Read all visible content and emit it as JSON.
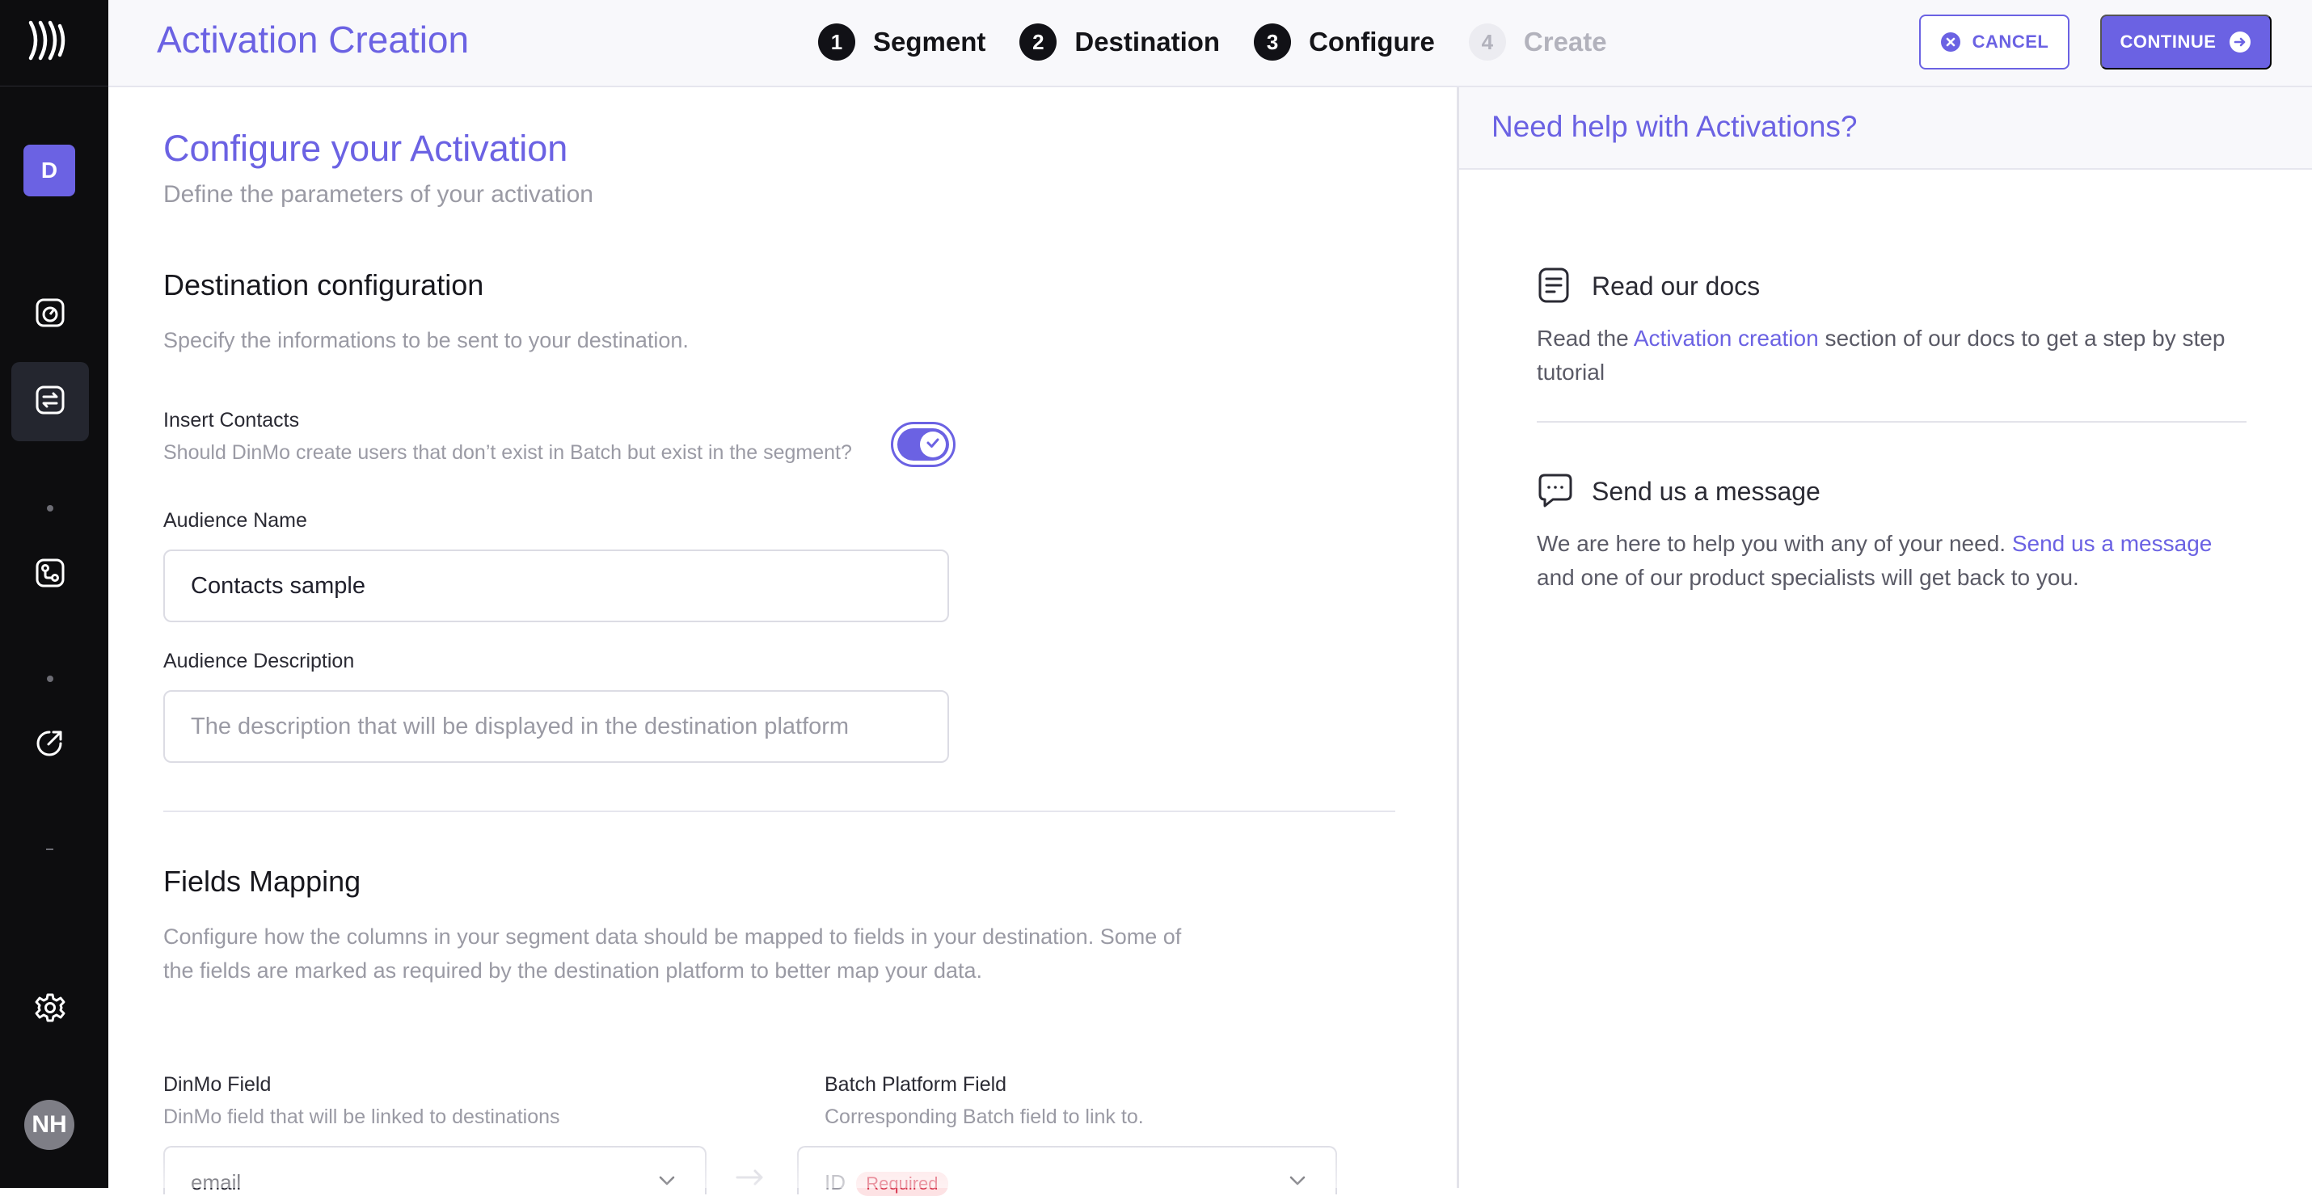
{
  "header": {
    "title": "Activation Creation",
    "steps": [
      {
        "num": "1",
        "label": "Segment"
      },
      {
        "num": "2",
        "label": "Destination"
      },
      {
        "num": "3",
        "label": "Configure"
      },
      {
        "num": "4",
        "label": "Create"
      }
    ],
    "cancel_label": "CANCEL",
    "continue_label": "CONTINUE"
  },
  "sidebar": {
    "workspace_initial": "D",
    "user_initials": "NH"
  },
  "main": {
    "title": "Configure your Activation",
    "subtitle": "Define the parameters of your activation",
    "destination_config": {
      "heading": "Destination configuration",
      "description": "Specify the informations to be sent to your destination.",
      "insert_contacts": {
        "label": "Insert Contacts",
        "hint": "Should DinMo create users that don’t exist in Batch but exist in the segment?",
        "enabled": true
      },
      "audience_name": {
        "label": "Audience Name",
        "value": "Contacts sample",
        "placeholder": ""
      },
      "audience_description": {
        "label": "Audience Description",
        "value": "",
        "placeholder": "The description that will be displayed in the destination platform"
      }
    },
    "fields_mapping": {
      "heading": "Fields Mapping",
      "description": "Configure how the columns in your segment data should be mapped to fields in your destination. Some of the fields are marked as required by the destination platform to better map your data.",
      "dinmo_field": {
        "label": "DinMo Field",
        "hint": "DinMo field that will be linked to destinations",
        "selected": "email"
      },
      "batch_field": {
        "label": "Batch Platform Field",
        "hint": "Corresponding Batch field to link to.",
        "selected": "ID",
        "badge": "Required"
      }
    }
  },
  "help": {
    "title": "Need help with Activations?",
    "docs": {
      "title": "Read our docs",
      "text_before": "Read the ",
      "link": "Activation creation",
      "text_after": " section of our docs to get a step by step tutorial"
    },
    "message": {
      "title": "Send us a message",
      "text_before": "We are here to help you with any of your need. ",
      "link": "Send us a message",
      "text_after": " and one of our product specialists will get back to you."
    }
  },
  "colors": {
    "accent": "#6b62e3",
    "sidebar_bg": "#0d0d0f",
    "required_badge": "#d6324a"
  }
}
